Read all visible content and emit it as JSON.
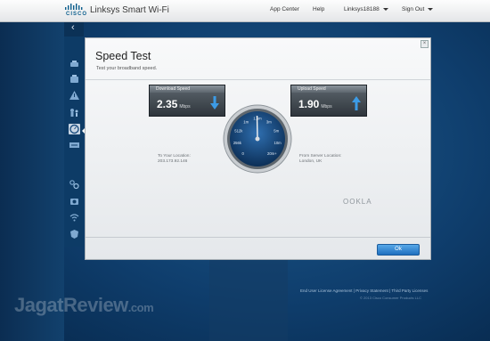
{
  "brand": {
    "logo_text": "CISCO",
    "app_title": "Linksys Smart Wi-Fi"
  },
  "topnav": {
    "app_center": "App Center",
    "help": "Help",
    "router_name": "Linksys18188",
    "sign_out": "Sign Out"
  },
  "sidebar": {
    "back_glyph": "‹",
    "icons": [
      "network-map-icon",
      "device-list-icon",
      "alert-icon",
      "parental-controls-icon",
      "media-prioritization-icon",
      "speed-test-icon",
      "external-storage-icon",
      "connectivity-icon",
      "troubleshooting-icon",
      "wireless-icon",
      "security-icon"
    ],
    "active": "speed-test-icon"
  },
  "modal": {
    "title": "Speed Test",
    "subtitle": "Test your broadband speed.",
    "ok_label": "Ok",
    "brand_footer": "OOKLA"
  },
  "download": {
    "label": "Download Speed",
    "value": "2.35",
    "unit": "Mbps",
    "location_label": "To Your Location:",
    "location_value": "203.173.92.146"
  },
  "upload": {
    "label": "Upload Speed",
    "value": "1.90",
    "unit": "Mbps",
    "location_label": "From Server Location:",
    "location_value": "London, UK"
  },
  "gauge": {
    "scale_labels": [
      "0",
      "256k",
      "512k",
      "1m",
      "1.5m",
      "3m",
      "5m",
      "10m",
      "20m+"
    ]
  },
  "footer": {
    "links": [
      "End User License Agreement",
      "Privacy Statement",
      "Third Party Licenses"
    ],
    "copyright": "© 2013 Cisco Consumer Products LLC"
  },
  "watermark": {
    "main": "JagatReview",
    "suffix": ".com"
  },
  "colors": {
    "accent_blue": "#1f6fbf",
    "background": "#0f3e6d",
    "panel_dark": "#2f363c"
  }
}
